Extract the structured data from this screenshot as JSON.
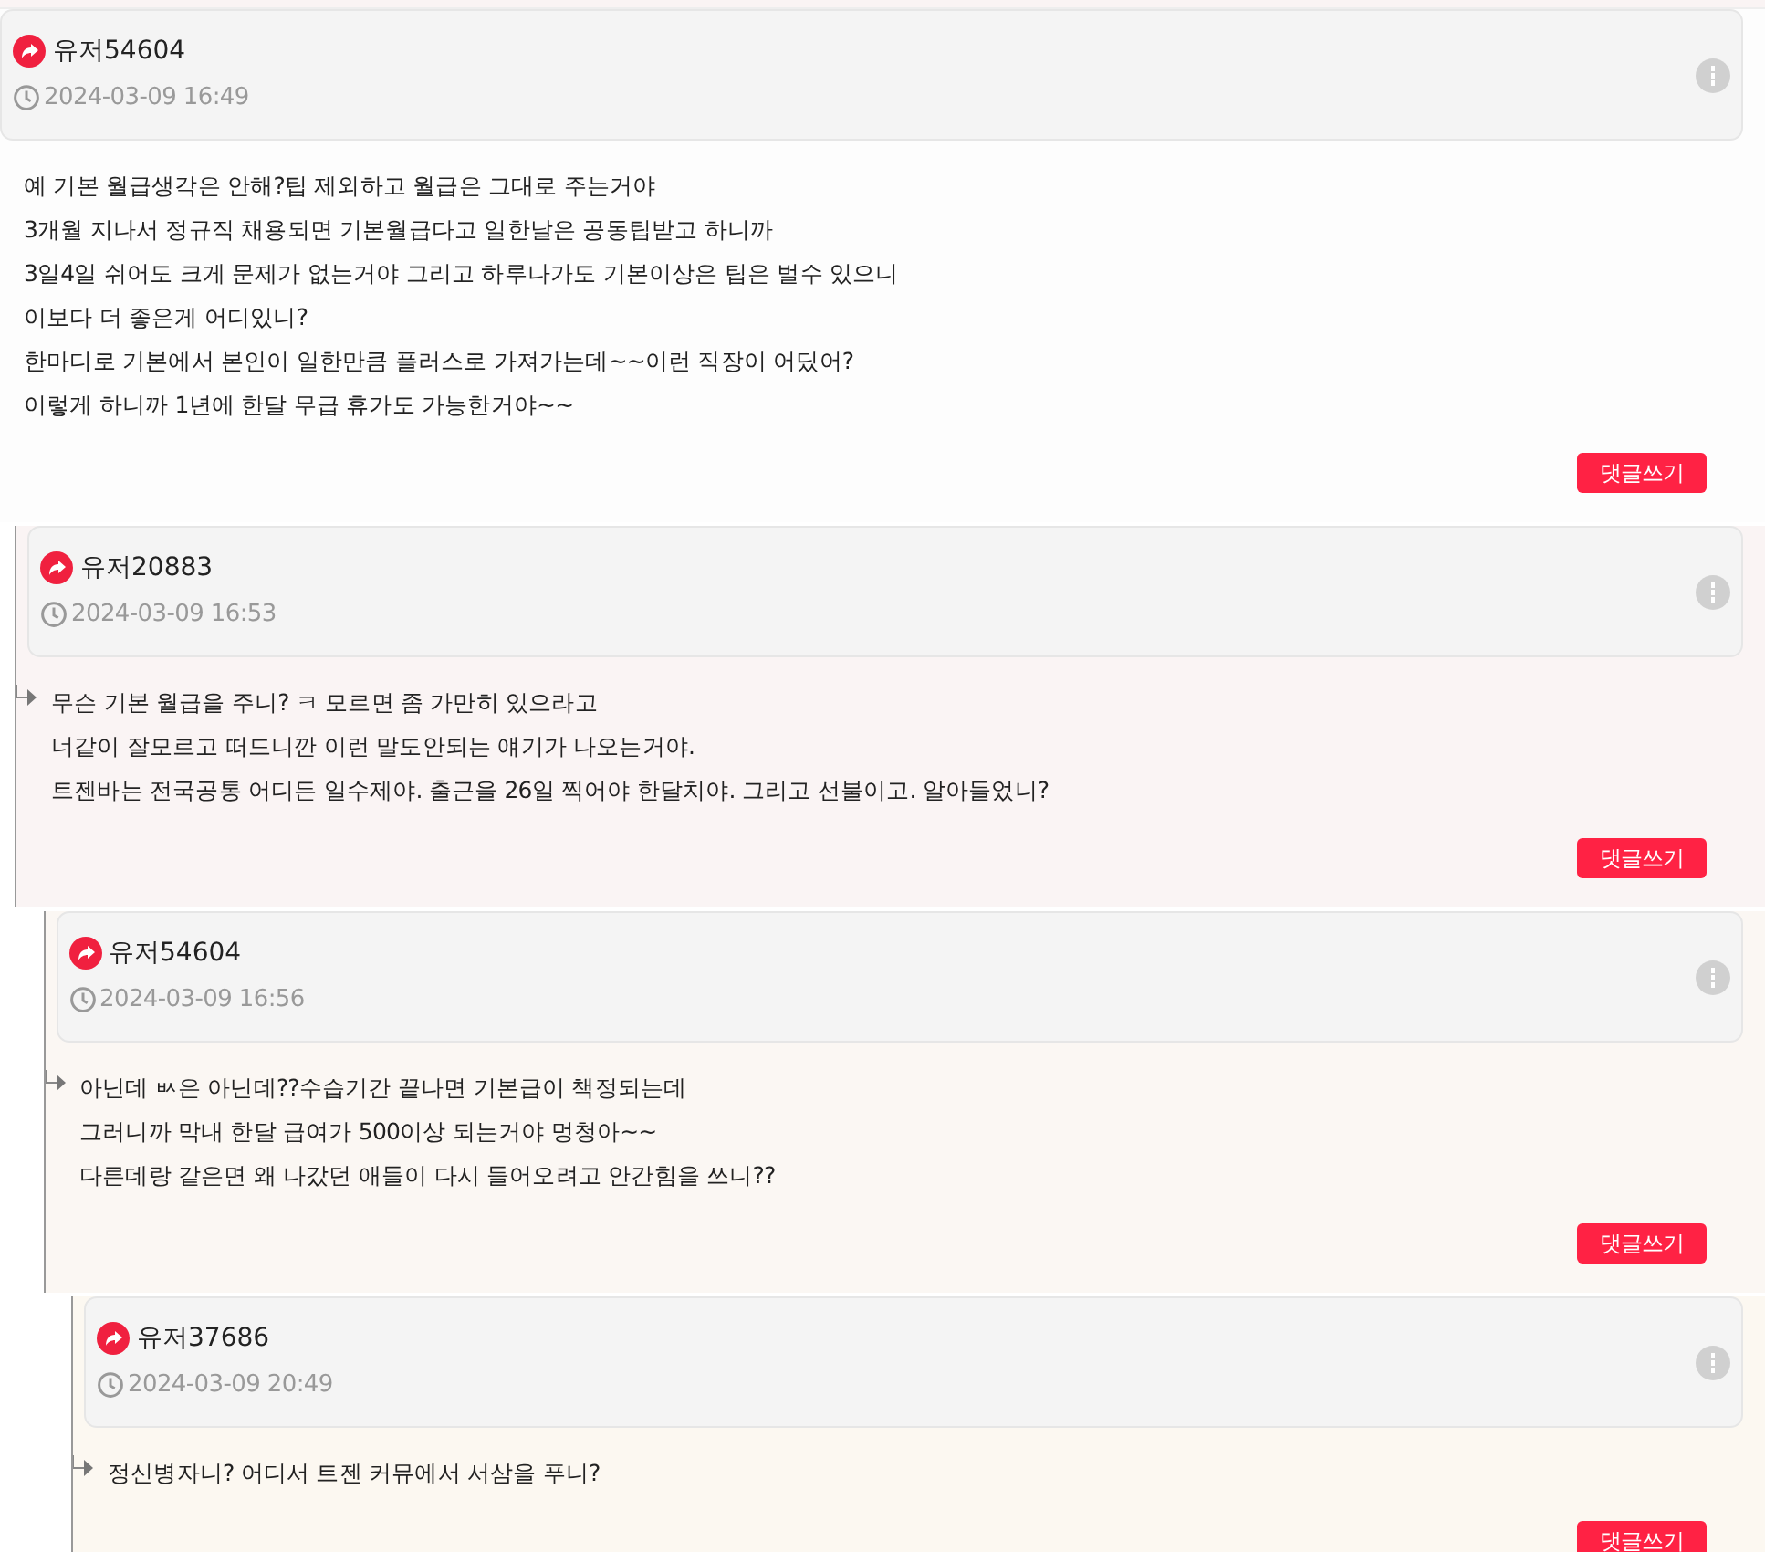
{
  "comments": [
    {
      "user": "유저54604",
      "time": "2024-03-09 16:49",
      "lines": [
        "예 기본 월급생각은 안해?팁 제외하고 월급은 그대로 주는거야",
        "3개월 지나서 정규직 채용되면 기본월급다고 일한날은 공동팁받고 하니까",
        "3일4일 쉬어도 크게 문제가 없는거야 그리고 하루나가도 기본이상은 팁은 벌수 있으니",
        "이보다 더 좋은게 어디있니?",
        "한마디로 기본에서 본인이 일한만큼 플러스로 가져가는데~~이런 직장이 어딨어?",
        "이렇게 하니까 1년에 한달 무급 휴가도 가능한거야~~"
      ],
      "reply_button": "댓글쓰기",
      "children": [
        {
          "user": "유저20883",
          "time": "2024-03-09 16:53",
          "lines": [
            "무슨 기본 월급을 주니? ㅋ 모르면 좀 가만히 있으라고",
            "너같이 잘모르고 떠드니깐 이런 말도안되는 얘기가 나오는거야.",
            "트젠바는 전국공통 어디든 일수제야.  출근을 26일 찍어야 한달치야. 그리고 선불이고.  알아들었니?"
          ],
          "reply_button": "댓글쓰기",
          "children": [
            {
              "user": "유저54604",
              "time": "2024-03-09 16:56",
              "lines": [
                "아닌데 ㅄ은 아닌데??수습기간 끝나면 기본급이 책정되는데",
                "그러니까 막내 한달 급여가 500이상 되는거야 멍청아~~",
                "다른데랑 같은면 왜 나갔던 애들이 다시 들어오려고 안간힘을 쓰니??"
              ],
              "reply_button": "댓글쓰기",
              "children": [
                {
                  "user": "유저37686",
                  "time": "2024-03-09 20:49",
                  "lines": [
                    "정신병자니? 어디서 트젠 커뮤에서 서삼을 푸니?"
                  ],
                  "reply_button": "댓글쓰기"
                }
              ]
            }
          ]
        }
      ]
    }
  ]
}
